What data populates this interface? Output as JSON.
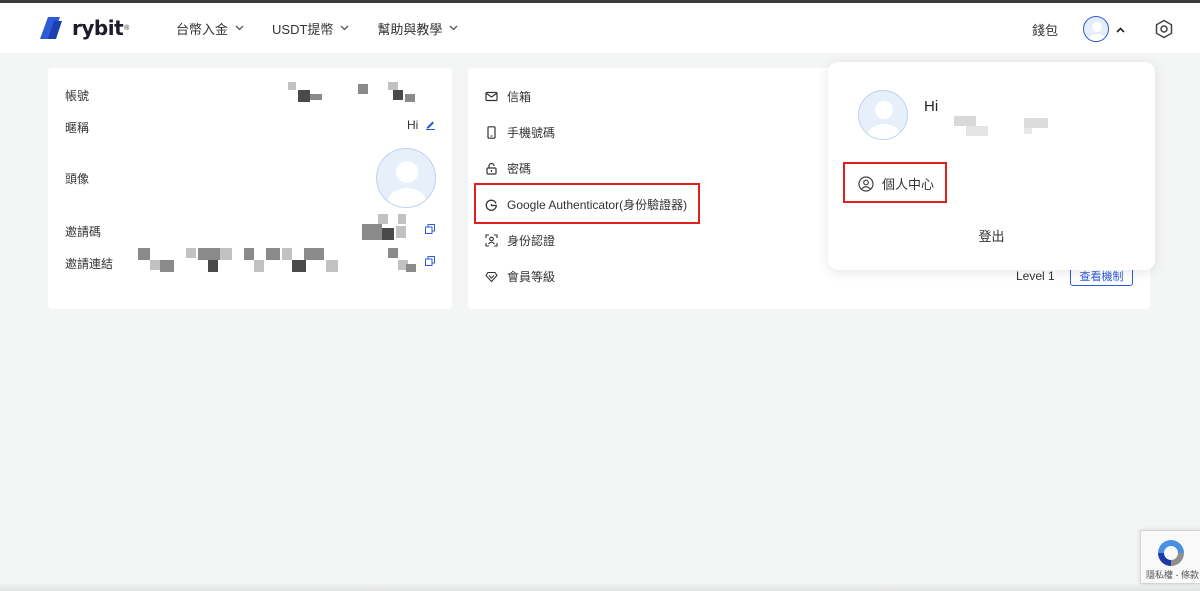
{
  "brand": {
    "logo_text": "rybit",
    "reg_mark": "®"
  },
  "nav": {
    "items": [
      {
        "label": "台幣入金"
      },
      {
        "label": "USDT提幣"
      },
      {
        "label": "幫助與教學"
      }
    ],
    "wallet_label": "錢包"
  },
  "account": {
    "account_label": "帳號",
    "nickname_label": "暱稱",
    "nickname_value": "Hi",
    "avatar_label": "頭像",
    "invite_code_label": "邀請碼",
    "invite_link_label": "邀請連結"
  },
  "security": {
    "items": [
      {
        "label": "信箱",
        "icon": "mail-icon"
      },
      {
        "label": "手機號碼",
        "icon": "phone-icon"
      },
      {
        "label": "密碼",
        "icon": "lock-icon"
      },
      {
        "label": "Google Authenticator(身份驗證器)",
        "icon": "google-icon"
      },
      {
        "label": "身份認證",
        "icon": "id-scan-icon"
      },
      {
        "label": "會員等級",
        "icon": "diamond-icon"
      }
    ],
    "level_value": "Level 1",
    "mechanism_button": "查看機制"
  },
  "user_menu": {
    "greeting": "Hi",
    "personal_center": "個人中心",
    "logout": "登出"
  },
  "recaptcha": {
    "text": "隱私權 - 條款"
  },
  "colors": {
    "accent": "#2d5bd7",
    "highlight_box": "#e0201c",
    "background": "#f4f5f5"
  }
}
